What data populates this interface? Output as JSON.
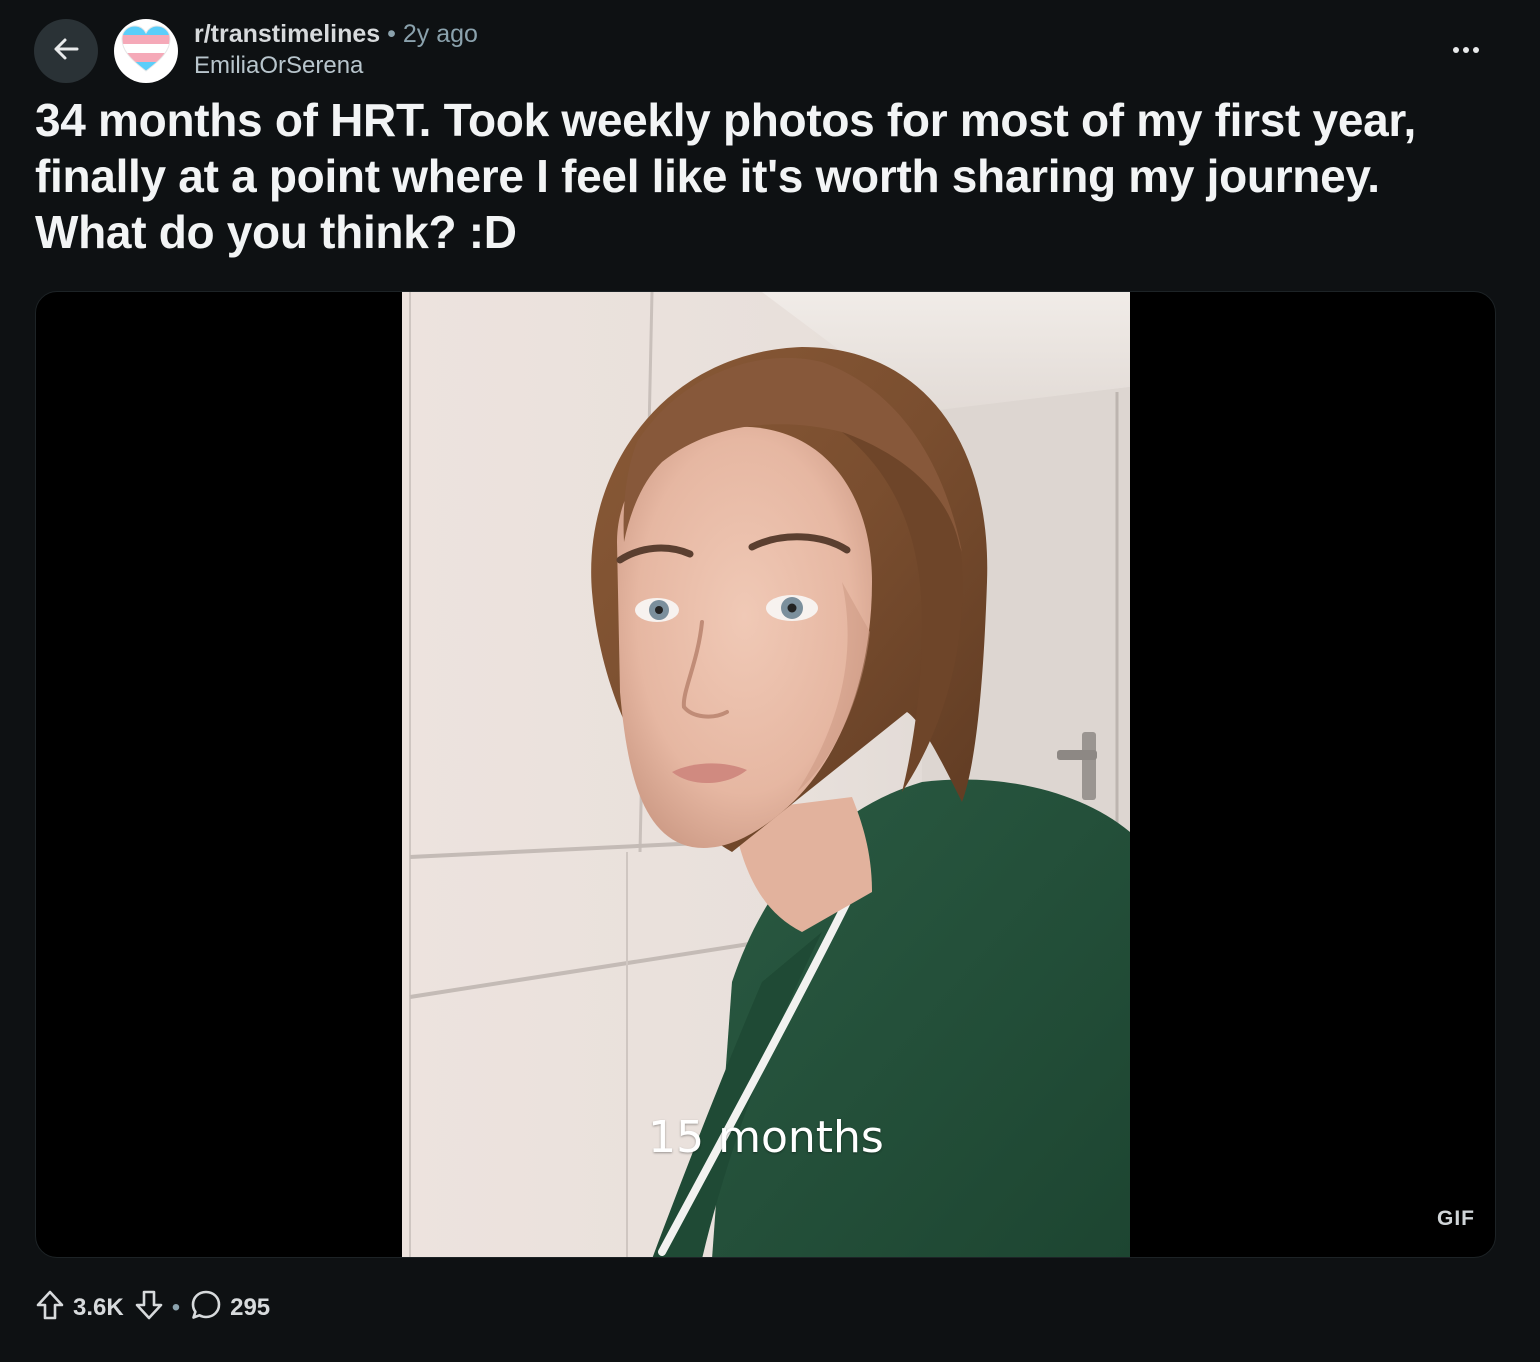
{
  "post": {
    "subreddit": "r/transtimelines",
    "separator": "•",
    "age": "2y ago",
    "author": "EmiliaOrSerena",
    "title": "34 months of HRT. Took weekly photos for most of my first year, finally at a point where I feel like it's worth sharing my journey. What do you think? :D"
  },
  "media": {
    "caption": "15 months",
    "badge": "GIF"
  },
  "actions": {
    "score": "3.6K",
    "separator": "•",
    "comments": "295"
  },
  "icons": {
    "back": "arrow-left-icon",
    "avatar": "trans-heart-icon",
    "more": "more-options-icon",
    "upvote": "upvote-icon",
    "downvote": "downvote-icon",
    "comment": "comment-bubble-icon"
  },
  "colors": {
    "background": "#0e1113",
    "back_button": "#2a3236",
    "trans_blue": "#5bcefa",
    "trans_pink": "#f5a9b8",
    "secondary_text": "#8ba2ad"
  }
}
